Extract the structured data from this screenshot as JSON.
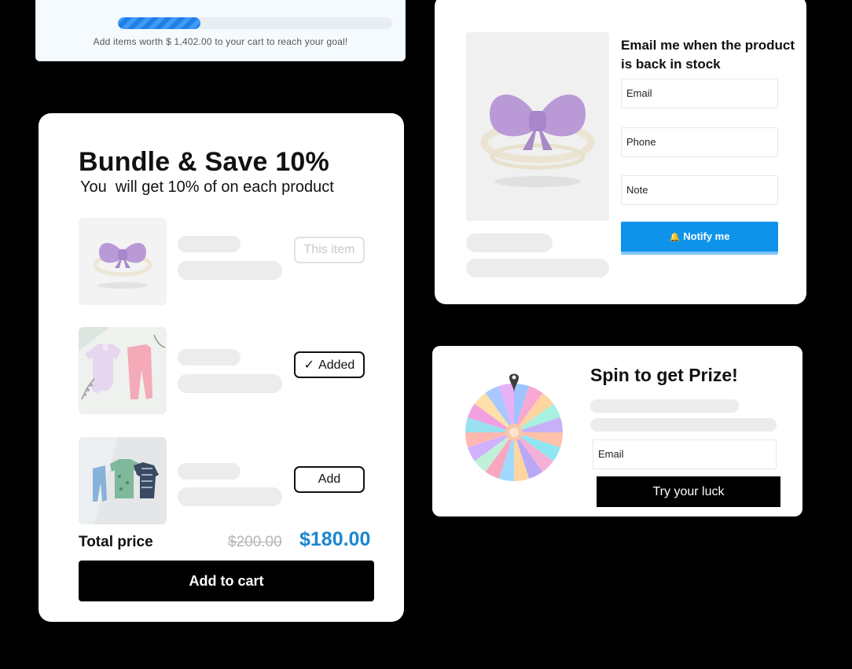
{
  "progress": {
    "text": "Add items worth $ 1,402.00 to your cart to reach your goal!",
    "fill_percent": 30
  },
  "bundle": {
    "title": "Bundle & Save 10%",
    "subtitle": "You  will get 10% of on each product",
    "items": [
      {
        "button_label": "This item",
        "state": "current",
        "image": "bow-headband"
      },
      {
        "button_label": "Added",
        "state": "added",
        "image": "baby-romper-and-pants"
      },
      {
        "button_label": "Add",
        "state": "add",
        "image": "kids-clothing-set"
      }
    ],
    "total_label": "Total price",
    "old_price": "$200.00",
    "new_price": "$180.00",
    "cart_button": "Add to cart"
  },
  "notify": {
    "title": "Email me when the product is back in stock",
    "email_placeholder": "Email",
    "phone_placeholder": "Phone",
    "note_placeholder": "Note",
    "button": "Notify me",
    "image": "bow-headband",
    "accent": "#0f93ea"
  },
  "spin": {
    "title": "Spin to get Prize!",
    "email_placeholder": "Email",
    "button": "Try your luck",
    "segment_colors": [
      "#9fc3ff",
      "#f9a8d4",
      "#fcd5a0",
      "#a8f0e0",
      "#c7b0f5",
      "#ffc1a8",
      "#8fe6f2",
      "#f5b0d8",
      "#b8a8f5",
      "#ffd6a0",
      "#a0d8ff",
      "#f7a8c0",
      "#c0f0d8",
      "#d0b0ff",
      "#ffb8b0",
      "#98e0f0",
      "#f3a0e0",
      "#ffe0a8",
      "#a8c8ff",
      "#e8b0f5"
    ]
  }
}
